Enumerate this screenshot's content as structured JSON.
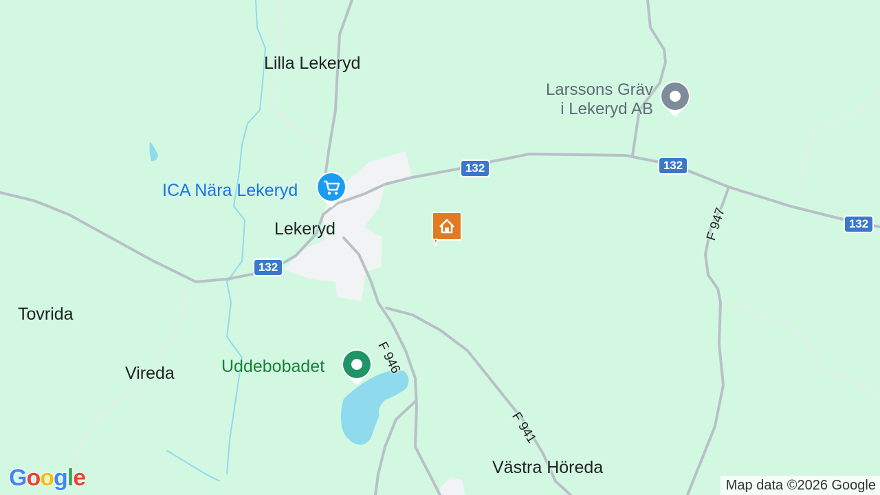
{
  "map": {
    "background_color": "#d3f8e2",
    "water_color": "#8fdaed",
    "road_color": "#b7c1c7",
    "urban_color": "#f1f3f4"
  },
  "places": {
    "lilla_lekeryd": "Lilla Lekeryd",
    "lekeryd": "Lekeryd",
    "tovrida": "Tovrida",
    "vireda": "Vireda",
    "vastra_horeda": "Västra Höreda"
  },
  "pois": {
    "larssons_line1": "Larssons Gräv",
    "larssons_line2": "i Lekeryd AB",
    "ica": "ICA Nära Lekeryd",
    "uddebobadet": "Uddebobadet"
  },
  "roads": {
    "shield_132": "132",
    "f946": "F 946",
    "f941": "F 941",
    "f947": "F 947"
  },
  "icons": {
    "ica_marker": "shopping-cart-icon",
    "larssons_marker": "location-pin-icon",
    "uddebobadet_marker": "park-pin-icon",
    "house_marker": "home-icon"
  },
  "colors": {
    "shopping_pin": "#1a9cf0",
    "park_pin": "#1e9467",
    "generic_pin": "#7e8c99",
    "house_pin": "#e07b22"
  },
  "attribution": "Map data ©2026 Google",
  "logo": {
    "G": "G",
    "o1": "o",
    "o2": "o",
    "g": "g",
    "l": "l",
    "e": "e"
  }
}
